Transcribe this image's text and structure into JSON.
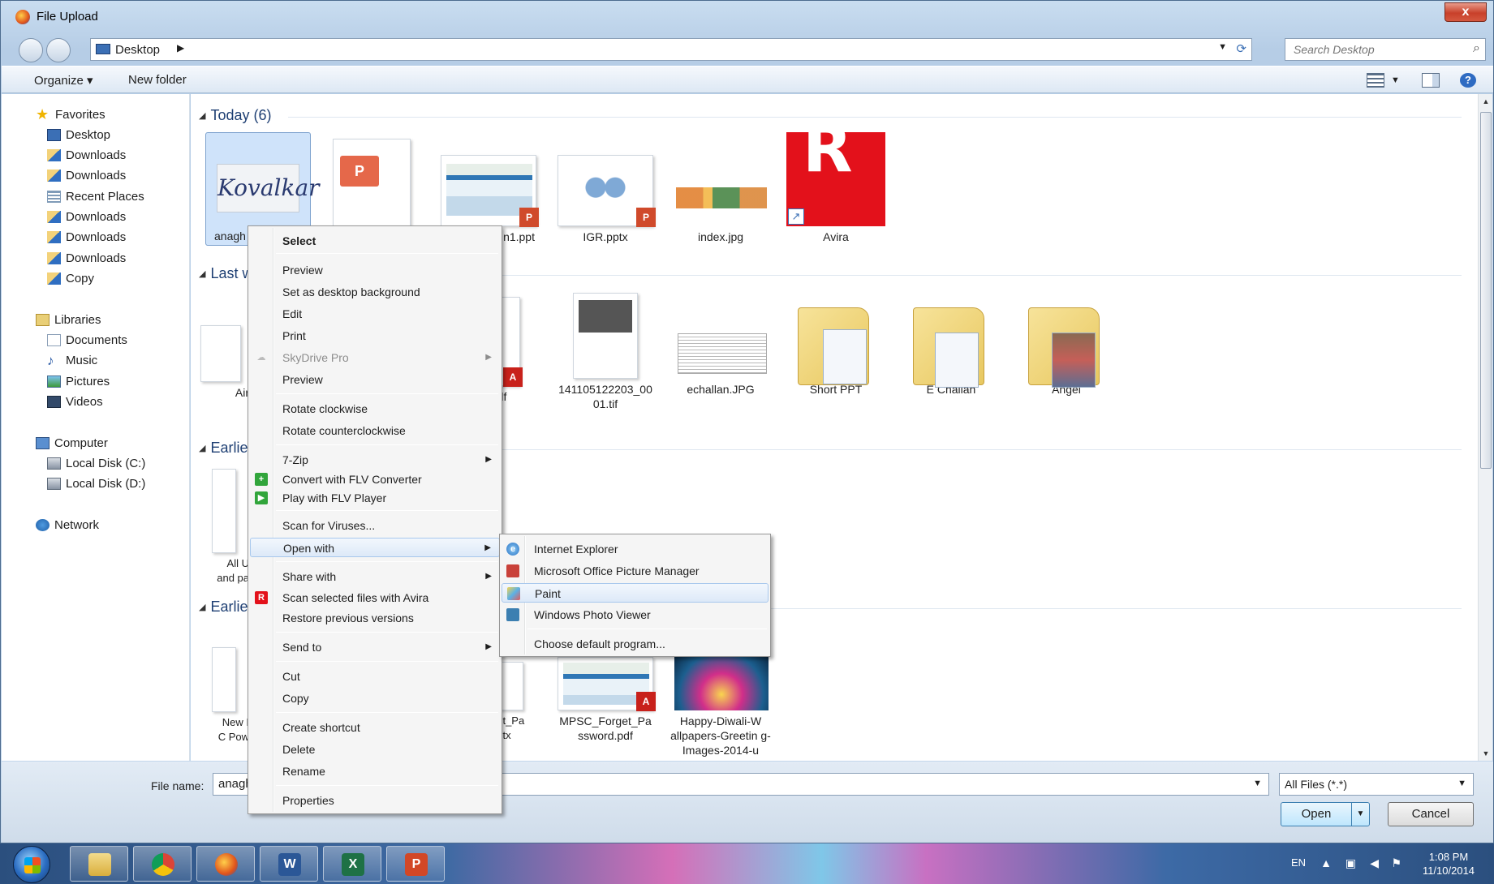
{
  "window": {
    "title": "File Upload",
    "close_label": "x"
  },
  "address": {
    "crumb": "Desktop",
    "search_placeholder": "Search Desktop"
  },
  "toolbar": {
    "organize": "Organize ▾",
    "new_folder": "New folder"
  },
  "nav": {
    "favorites": "Favorites",
    "fav_items": [
      "Desktop",
      "Downloads",
      "Downloads",
      "Recent Places",
      "Downloads",
      "Downloads",
      "Downloads",
      "Copy"
    ],
    "libraries": "Libraries",
    "lib_items": [
      "Documents",
      "Music",
      "Pictures",
      "Videos"
    ],
    "computer": "Computer",
    "comp_items": [
      "Local Disk (C:)",
      "Local Disk (D:)"
    ],
    "network": "Network"
  },
  "groups": {
    "today": "Today (6)",
    "last": "Last w",
    "earlier1": "Earlie",
    "earlier2": "Earlie"
  },
  "files": {
    "today": [
      "anagh",
      "",
      "n1.ppt",
      "IGR.pptx",
      "index.jpg",
      "Avira"
    ],
    "last": [
      "Air",
      ".pdf",
      "141105122203_00 01.tif",
      "echallan.JPG",
      "Short PPT",
      "E Challan",
      "Angel"
    ],
    "earlier1": [
      "All U and pa"
    ],
    "earlier2": [
      "New I C Pow",
      "get_Pa pptx",
      "MPSC_Forget_Pa ssword.pdf",
      "Happy-Diwali-W allpapers-Greetin g-Images-2014-u"
    ],
    "thumb_texts": {
      "signature": "Kovalkar",
      "ppt_logo": "P",
      "ppt_badge": "P",
      "pdf_badge": "A",
      "avira_mark": "R",
      "shortcut": "↗"
    }
  },
  "bottom": {
    "file_name_label": "File name:",
    "file_name_value": "anagh",
    "filter": "All Files (*.*)",
    "open": "Open",
    "cancel": "Cancel"
  },
  "context_menu": {
    "select": "Select",
    "preview": "Preview",
    "set_bg": "Set as desktop background",
    "edit": "Edit",
    "print": "Print",
    "skydrive": "SkyDrive Pro",
    "preview2": "Preview",
    "rotate_cw": "Rotate clockwise",
    "rotate_ccw": "Rotate counterclockwise",
    "zip": "7-Zip",
    "flv_convert": "Convert with FLV Converter",
    "flv_play": "Play with FLV Player",
    "scan_viruses": "Scan for Viruses...",
    "open_with": "Open with",
    "share_with": "Share with",
    "scan_avira": "Scan selected files with Avira",
    "restore": "Restore previous versions",
    "send_to": "Send to",
    "cut": "Cut",
    "copy": "Copy",
    "create_shortcut": "Create shortcut",
    "delete": "Delete",
    "rename": "Rename",
    "properties": "Properties"
  },
  "open_with_menu": {
    "ie": "Internet Explorer",
    "picture_manager": "Microsoft Office Picture Manager",
    "paint": "Paint",
    "photo_viewer": "Windows Photo Viewer",
    "choose_default": "Choose default program..."
  },
  "taskbar": {
    "lang": "EN",
    "time": "1:08 PM",
    "date": "11/10/2014",
    "app_icons": [
      "explorer-icon",
      "chrome-icon",
      "firefox-icon",
      "word-icon",
      "excel-icon",
      "powerpoint-icon"
    ],
    "app_letters": {
      "word": "W",
      "excel": "X",
      "powerpoint": "P"
    }
  },
  "colors": {
    "accent": "#3c7fb1",
    "highlight": "#dde9f8",
    "avira_red": "#e3111b"
  }
}
